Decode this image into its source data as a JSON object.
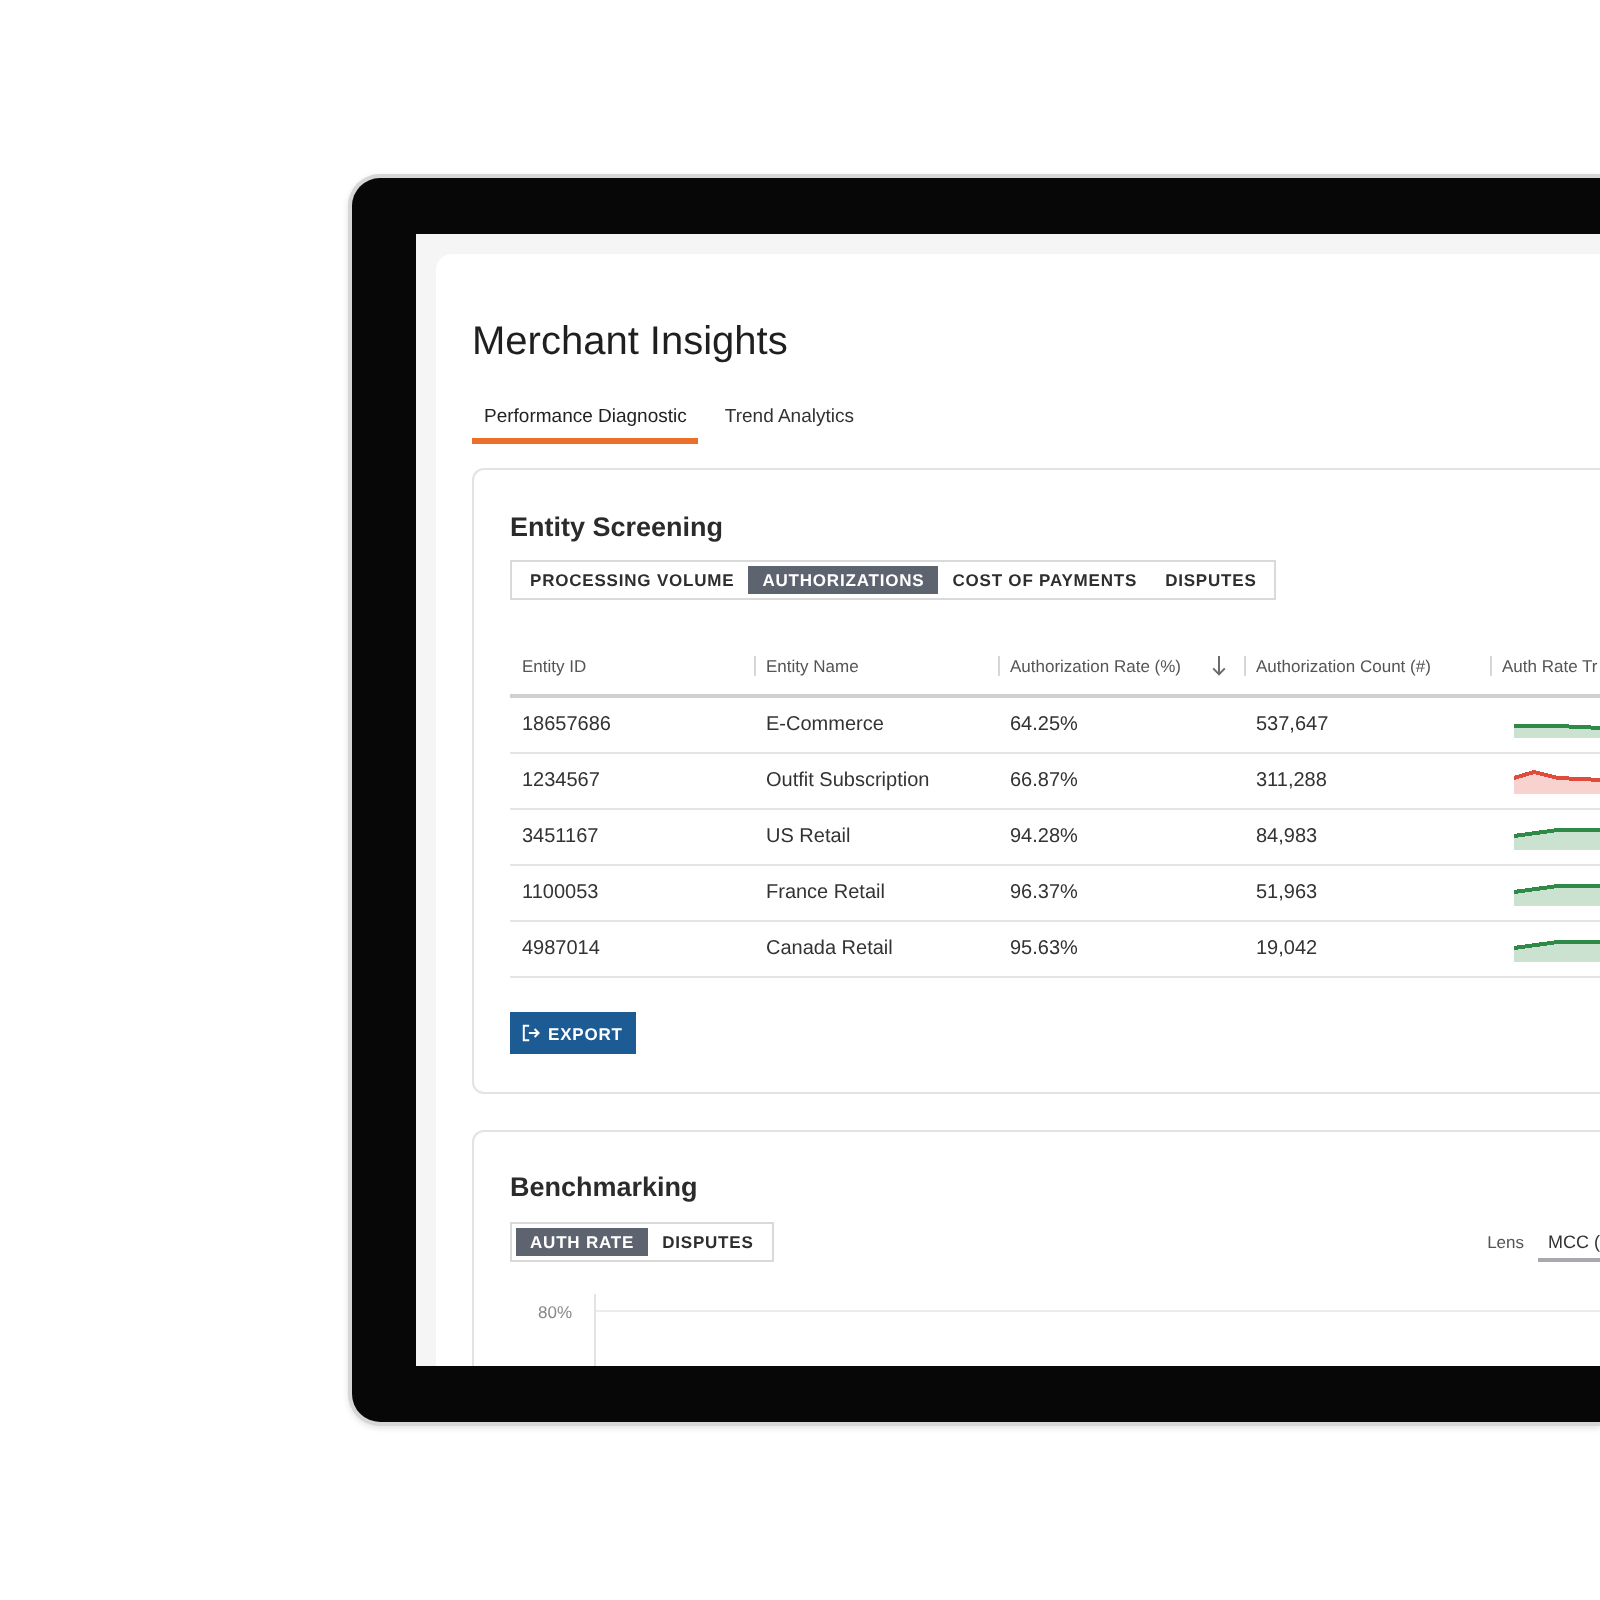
{
  "page": {
    "title": "Merchant Insights"
  },
  "tabs": [
    {
      "label": "Performance Diagnostic",
      "selected": true
    },
    {
      "label": "Trend Analytics",
      "selected": false
    }
  ],
  "entity_screening": {
    "title": "Entity Screening",
    "segments": [
      {
        "label": "PROCESSING VOLUME",
        "selected": false
      },
      {
        "label": "AUTHORIZATIONS",
        "selected": true
      },
      {
        "label": "COST OF PAYMENTS",
        "selected": false
      },
      {
        "label": "DISPUTES",
        "selected": false
      }
    ],
    "table": {
      "columns": [
        {
          "label": "Entity ID",
          "sorted": false
        },
        {
          "label": "Entity Name",
          "sorted": false
        },
        {
          "label": "Authorization Rate (%)",
          "sorted": true
        },
        {
          "label": "Authorization Count (#)",
          "sorted": false
        },
        {
          "label": "Auth Rate Tr",
          "sorted": false
        }
      ],
      "rows": [
        {
          "entity_id": "18657686",
          "entity_name": "E-Commerce",
          "authorization_rate": "64.25%",
          "authorization_count": "537,647",
          "trend": {
            "kind": "flat",
            "color": "#2f8a47"
          }
        },
        {
          "entity_id": "1234567",
          "entity_name": "Outfit Subscription",
          "authorization_rate": "66.87%",
          "authorization_count": "311,288",
          "trend": {
            "kind": "peak",
            "color": "#e04b3c"
          }
        },
        {
          "entity_id": "3451167",
          "entity_name": "US Retail",
          "authorization_rate": "94.28%",
          "authorization_count": "84,983",
          "trend": {
            "kind": "rising",
            "color": "#2f8a47"
          }
        },
        {
          "entity_id": "1100053",
          "entity_name": "France Retail",
          "authorization_rate": "96.37%",
          "authorization_count": "51,963",
          "trend": {
            "kind": "rising",
            "color": "#2f8a47"
          }
        },
        {
          "entity_id": "4987014",
          "entity_name": "Canada Retail",
          "authorization_rate": "95.63%",
          "authorization_count": "19,042",
          "trend": {
            "kind": "rising",
            "color": "#2f8a47"
          }
        }
      ]
    },
    "export_button": "EXPORT"
  },
  "benchmarking": {
    "title": "Benchmarking",
    "segments": [
      {
        "label": "AUTH RATE",
        "selected": true
      },
      {
        "label": "DISPUTES",
        "selected": false
      }
    ],
    "lens": {
      "label": "Lens",
      "value": "MCC ("
    },
    "chart": {
      "y_tick_labels": [
        "80%"
      ]
    }
  }
}
